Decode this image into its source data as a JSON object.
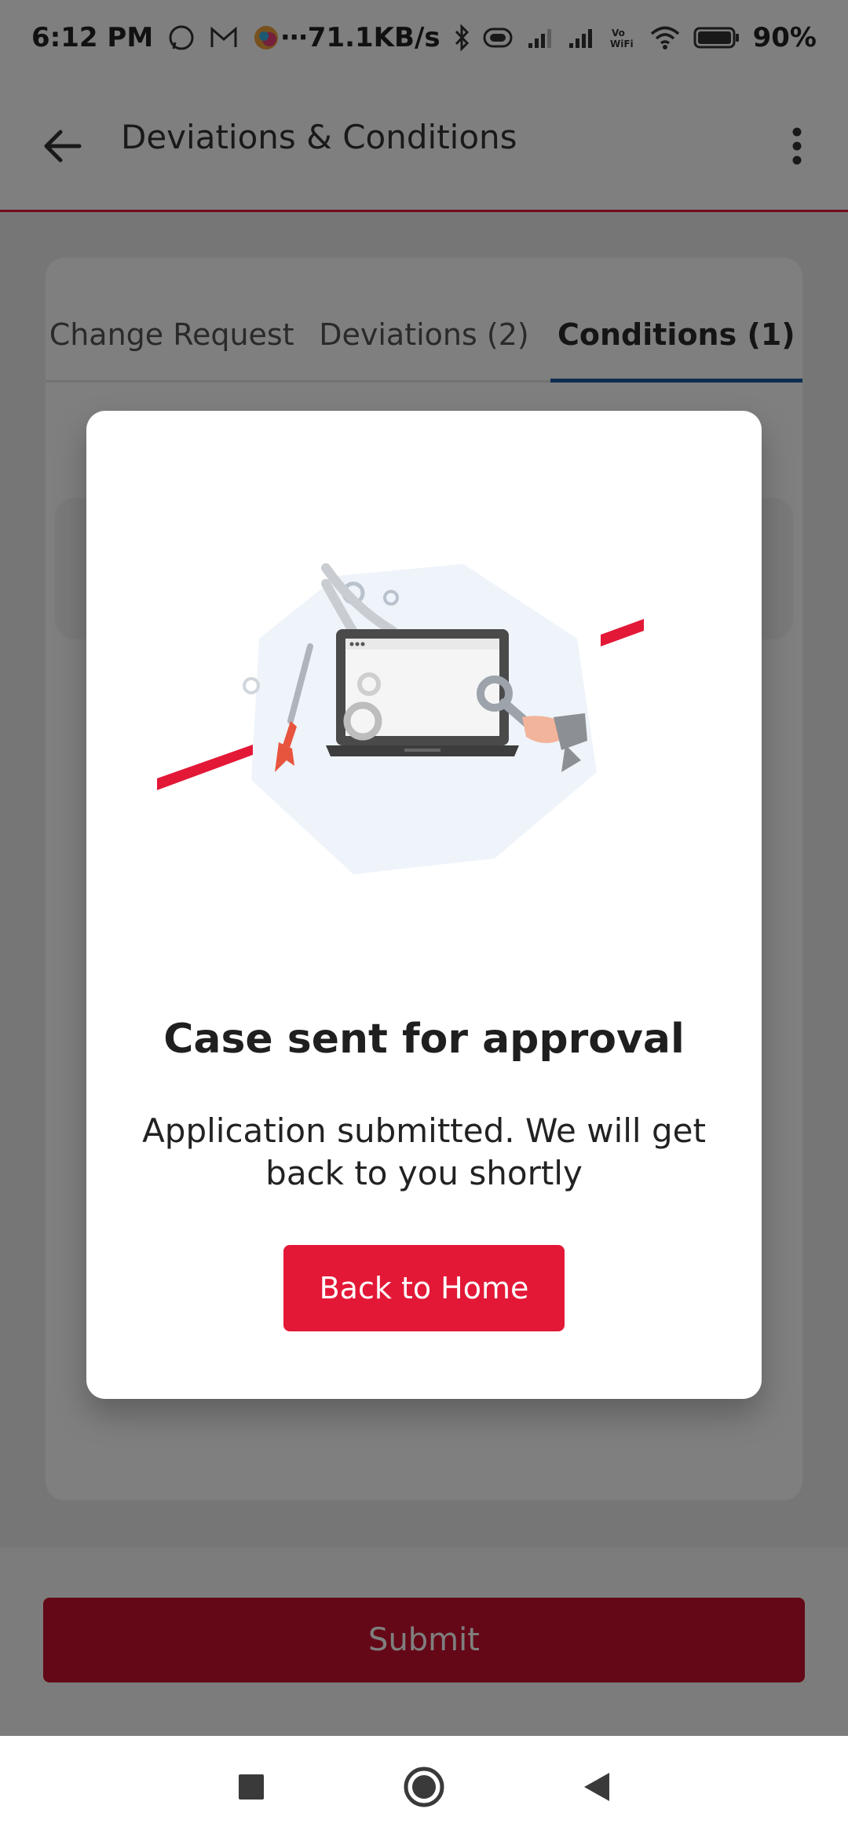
{
  "status_bar": {
    "time": "6:12 PM",
    "network_speed": "⋯71.1KB/s",
    "battery": "90%",
    "icons": [
      "whatsapp-icon",
      "gmail-icon",
      "browser-icon",
      "bluetooth-icon",
      "sim-signal-icon",
      "signal-icon",
      "vowifi-icon",
      "wifi-icon",
      "battery-icon"
    ]
  },
  "app_bar": {
    "title": "Deviations & Conditions"
  },
  "tabs": [
    {
      "label": "Change Request",
      "active": false
    },
    {
      "label": "Deviations (2)",
      "active": false
    },
    {
      "label": "Conditions (1)",
      "active": true
    }
  ],
  "footer": {
    "submit_label": "Submit"
  },
  "modal": {
    "title": "Case sent for approval",
    "message": "Application submitted. We will get back to you shortly",
    "button_label": "Back to Home"
  },
  "colors": {
    "brand_red": "#e31837",
    "tab_indicator": "#1a5aa5"
  }
}
